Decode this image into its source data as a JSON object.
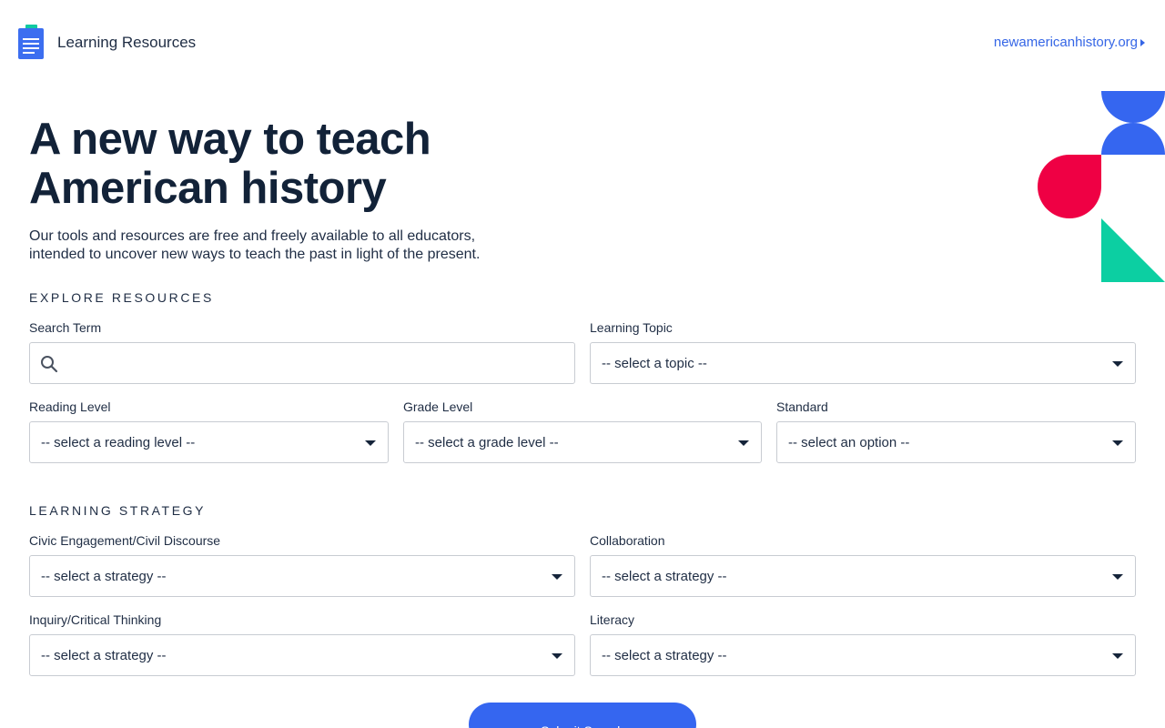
{
  "header": {
    "brand_title": "Learning Resources",
    "site_link": "newamericanhistory.org",
    "logo_icon": "document-icon"
  },
  "hero": {
    "title_line1": "A new way to teach",
    "title_line2": "American history",
    "desc_line1": "Our tools and resources are free and freely available to all educators,",
    "desc_line2": "intended to uncover new ways to teach the past in light of the present."
  },
  "explore": {
    "section_title": "EXPLORE RESOURCES",
    "search_label": "Search Term",
    "search_value": "",
    "topic_label": "Learning Topic",
    "topic_value": "-- select a topic --",
    "reading_label": "Reading Level",
    "reading_value": "-- select a reading level --",
    "grade_label": "Grade Level",
    "grade_value": "-- select a grade level --",
    "standard_label": "Standard",
    "standard_value": "-- select an option --"
  },
  "strategy": {
    "section_title": "LEARNING STRATEGY",
    "civic_label": "Civic Engagement/Civil Discourse",
    "civic_value": "-- select a strategy --",
    "collab_label": "Collaboration",
    "collab_value": "-- select a strategy --",
    "inquiry_label": "Inquiry/Critical Thinking",
    "inquiry_value": "-- select a strategy --",
    "literacy_label": "Literacy",
    "literacy_value": "-- select a strategy --"
  },
  "submit_label": "Submit Search",
  "colors": {
    "accent_blue": "#3566f0",
    "accent_red": "#ef0044",
    "accent_green": "#0ccfa2",
    "text_dark": "#122238"
  }
}
